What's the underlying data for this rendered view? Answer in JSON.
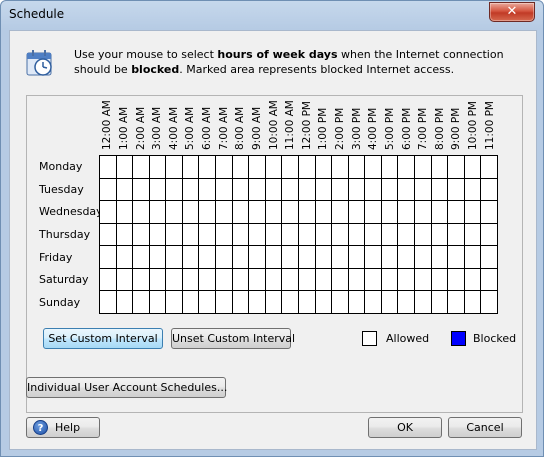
{
  "window": {
    "title": "Schedule",
    "close_glyph": "✕"
  },
  "info": {
    "icon": "calendar-clock-icon",
    "text_pre": "Use your mouse to select ",
    "text_bold1": "hours of week days",
    "text_mid": " when the Internet connection should be ",
    "text_bold2": "blocked",
    "text_post": ". Marked area represents blocked Internet access."
  },
  "schedule": {
    "hours": [
      "12:00 AM",
      "1:00 AM",
      "2:00 AM",
      "3:00 AM",
      "4:00 AM",
      "5:00 AM",
      "6:00 AM",
      "7:00 AM",
      "8:00 AM",
      "9:00 AM",
      "10:00 AM",
      "11:00 AM",
      "12:00 PM",
      "1:00 PM",
      "2:00 PM",
      "3:00 PM",
      "4:00 PM",
      "5:00 PM",
      "6:00 PM",
      "7:00 PM",
      "8:00 PM",
      "9:00 PM",
      "10:00 PM",
      "11:00 PM"
    ],
    "days": [
      "Monday",
      "Tuesday",
      "Wednesday",
      "Thursday",
      "Friday",
      "Saturday",
      "Sunday"
    ],
    "blocked_cells": []
  },
  "buttons": {
    "set_custom_interval": "Set Custom Interval",
    "unset_custom_interval": "Unset Custom Interval",
    "individual_schedules": "Individual User Account Schedules...",
    "help": "Help",
    "ok": "OK",
    "cancel": "Cancel"
  },
  "legend": {
    "allowed_label": "Allowed",
    "allowed_color": "#ffffff",
    "blocked_label": "Blocked",
    "blocked_color": "#0000ff"
  }
}
